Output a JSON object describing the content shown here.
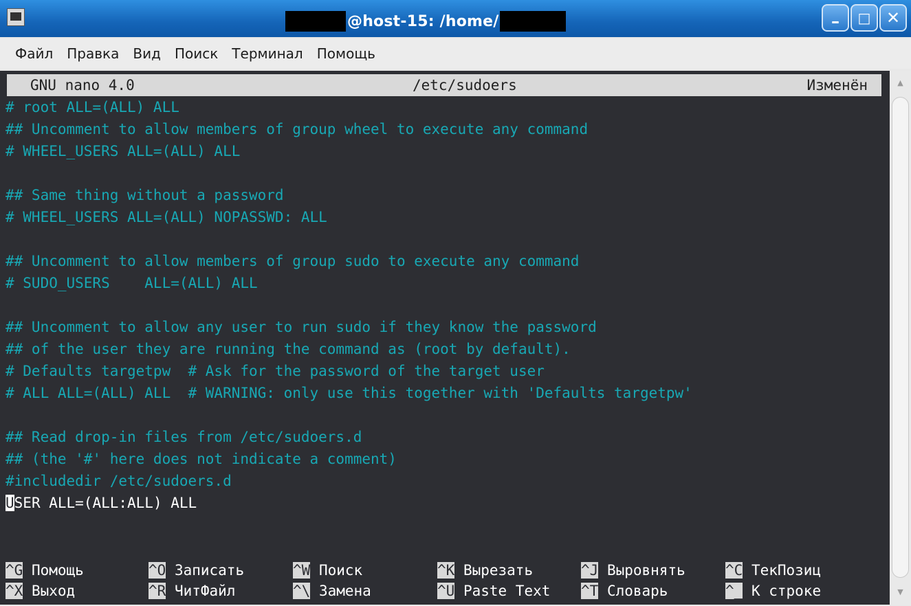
{
  "window": {
    "title": "@host-15: /home/",
    "buttons": {
      "minimize": "–",
      "maximize": "□",
      "close": "✕"
    },
    "icon": "terminal-icon"
  },
  "menu": [
    "Файл",
    "Правка",
    "Вид",
    "Поиск",
    "Терминал",
    "Помощь"
  ],
  "nano": {
    "version": "GNU nano 4.0",
    "filename": "/etc/sudoers",
    "status": "Изменён"
  },
  "lines": [
    "# root ALL=(ALL) ALL",
    "## Uncomment to allow members of group wheel to execute any command",
    "# WHEEL_USERS ALL=(ALL) ALL",
    "",
    "## Same thing without a password",
    "# WHEEL_USERS ALL=(ALL) NOPASSWD: ALL",
    "",
    "## Uncomment to allow members of group sudo to execute any command",
    "# SUDO_USERS    ALL=(ALL) ALL",
    "",
    "## Uncomment to allow any user to run sudo if they know the password",
    "## of the user they are running the command as (root by default).",
    "# Defaults targetpw  # Ask for the password of the target user",
    "# ALL ALL=(ALL) ALL  # WARNING: only use this together with 'Defaults targetpw'",
    "",
    "## Read drop-in files from /etc/sudoers.d",
    "## (the '#' here does not indicate a comment)",
    "#includedir /etc/sudoers.d"
  ],
  "user_line": {
    "cursor_char": "U",
    "rest": "SER ALL=(ALL:ALL) ALL"
  },
  "shortcuts": [
    [
      {
        "key": "^G",
        "label": "Помощь"
      },
      {
        "key": "^O",
        "label": "Записать"
      },
      {
        "key": "^W",
        "label": "Поиск"
      },
      {
        "key": "^K",
        "label": "Вырезать"
      },
      {
        "key": "^J",
        "label": "Выровнять"
      },
      {
        "key": "^C",
        "label": "ТекПозиц"
      }
    ],
    [
      {
        "key": "^X",
        "label": "Выход"
      },
      {
        "key": "^R",
        "label": "ЧитФайл"
      },
      {
        "key": "^\\",
        "label": "Замена"
      },
      {
        "key": "^U",
        "label": "Paste Text"
      },
      {
        "key": "^T",
        "label": "Словарь"
      },
      {
        "key": "^_",
        "label": "К строке"
      }
    ]
  ],
  "colors": {
    "terminal_bg": "#2d2e33",
    "comment": "#18a8b4",
    "text": "#ffffff",
    "titlebar": "#1565b8"
  }
}
